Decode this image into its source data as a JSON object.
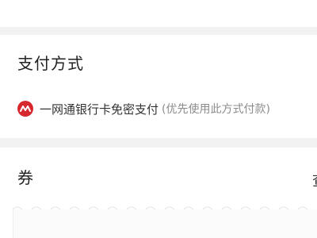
{
  "payment_section": {
    "title": "支付方式",
    "method": {
      "icon": "unionpay-icon",
      "label": "一网通银行卡免密支付",
      "note": "(优先使用此方式付款)"
    }
  },
  "coupon_section": {
    "title": "券",
    "right_text": "查"
  },
  "colors": {
    "brand_red": "#d7282f",
    "page_bg": "#f2f2f2"
  }
}
